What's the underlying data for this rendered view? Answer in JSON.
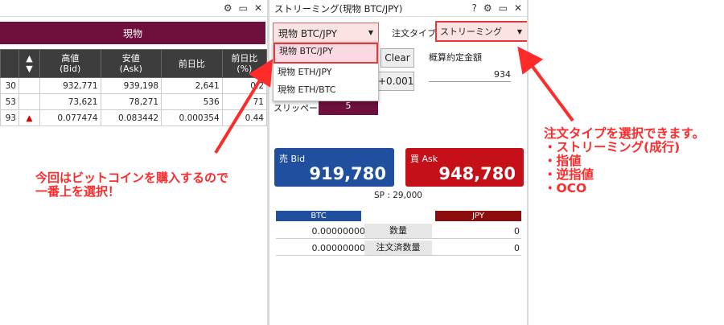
{
  "left": {
    "banner": "現物",
    "columns": [
      "▲\n▼",
      "高値\n(Bid)",
      "安値\n(Ask)",
      "前日比",
      "前日比\n(%)"
    ],
    "rows": [
      {
        "c0": "30",
        "arrow": "",
        "bid": "932,771",
        "ask": "939,198",
        "diff": "2,641",
        "pct": "0.2"
      },
      {
        "c0": "53",
        "arrow": "",
        "bid": "73,621",
        "ask": "78,271",
        "diff": "536",
        "pct": "71"
      },
      {
        "c0": "93",
        "arrow": "▲",
        "bid": "0.077474",
        "ask": "0.083442",
        "diff": "0.000354",
        "pct": "0.44"
      }
    ]
  },
  "right": {
    "title": "ストリーミング(現物 BTC/JPY)",
    "pair_selected": "現物 BTC/JPY",
    "pair_options": [
      "現物 BTC/JPY",
      "現物 ETH/JPY",
      "現物 ETH/BTC"
    ],
    "order_type_label": "注文タイプ",
    "order_type_value": "ストリーミング",
    "clear_button": "Clear",
    "plus_button": "+0.001",
    "est_label": "概算約定金額",
    "est_value": "934",
    "slippage_label": "スリッページ",
    "slippage_value": "5",
    "sell_label": "売 Bid",
    "sell_price": "919,780",
    "buy_label": "買 Ask",
    "buy_price": "948,780",
    "spread": "SP : 29,000",
    "balance": {
      "left_header": "BTC",
      "right_header": "JPY",
      "rows": [
        {
          "left": "0.00000000",
          "label": "数量",
          "right": "0"
        },
        {
          "left": "0.00000000",
          "label": "注文済数量",
          "right": "0"
        }
      ]
    }
  },
  "annotations": {
    "left_note": "今回はビットコインを購入するので\n一番上を選択！",
    "right_note": "注文タイプを選択できます。\n・ストリーミング(成行)\n・指値\n・逆指値\n・OCO"
  },
  "colors": {
    "banner": "#6e0f3c",
    "sell": "#1f4f9e",
    "buy": "#c5101a",
    "annotation": "#ff2a2a"
  }
}
